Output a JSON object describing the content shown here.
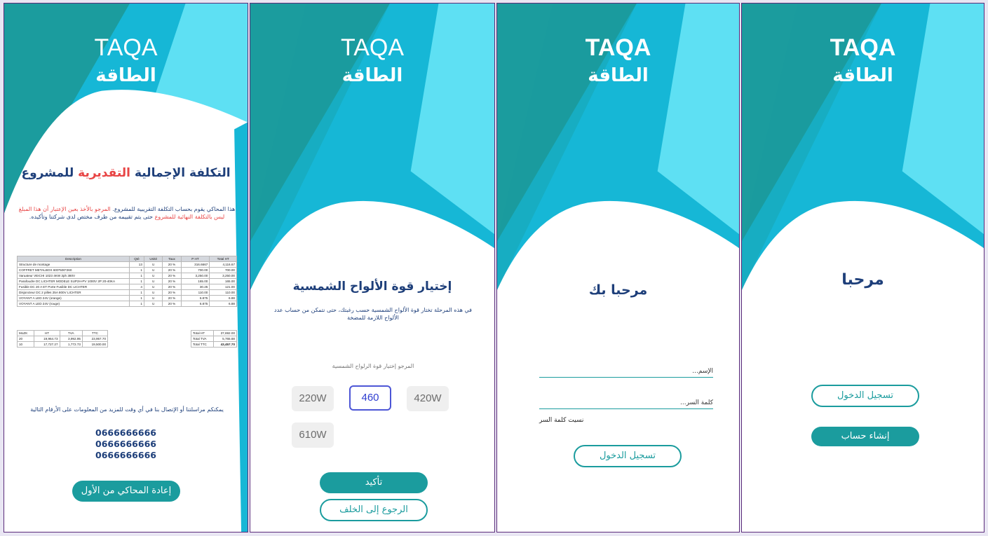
{
  "brand": {
    "name_en": "TAQA",
    "name_ar": "الطاقة"
  },
  "colors": {
    "teal": "#1b9c9e",
    "cyan": "#16b7d6",
    "light_cyan": "#5ee0f3",
    "navy": "#1e3f7a",
    "red": "#e84545",
    "accent_blue": "#2f3ed0"
  },
  "screen1": {
    "title_part1": "التكلفة الإجمالية",
    "title_part2": "التقديرية",
    "title_part3": "للمشروع",
    "desc_part1": "هذا المحاكي يقوم بحساب التكلفة التقريبية للمشروع.",
    "desc_part2": "المرجو بالأخذ بعين الإعتبار أن هذا المبلغ ليس بالتكلفة النهائية للمشروع",
    "desc_part3": "حتى يتم تقييمه من طرف مختص لدى شركتنا وتأكيده.",
    "table": {
      "headers": [
        "Description",
        "Qté",
        "Unité",
        "Taux",
        "P HT",
        "Total HT"
      ],
      "rows": [
        [
          "Structure de montage",
          "13",
          "U",
          "20 %",
          "316.6667",
          "4,116.67"
        ],
        [
          "COFFRET METALBOX 600*500*260",
          "1",
          "U",
          "20 %",
          "700.00",
          "700.00"
        ],
        [
          "Varuateur VEICHI 1023 4KW 3ph 380V",
          "1",
          "U",
          "20 %",
          "3,250.00",
          "3,250.00"
        ],
        [
          "Parafoudre DC LICHTER MODELE SUP2H-PV 1000V 2P 20-40KA",
          "1",
          "U",
          "20 %",
          "165.00",
          "165.00"
        ],
        [
          "Fusible DC 20 A ET Porte Fusible DC LICHTER",
          "4",
          "U",
          "20 %",
          "30.25",
          "121.00"
        ],
        [
          "Disjoncteur DC 2 pilles 25A 800V LICHTER",
          "1",
          "U",
          "20 %",
          "110.00",
          "110.00"
        ],
        [
          "VOYANT A LED 24V (orange)",
          "1",
          "U",
          "20 %",
          "6.875",
          "6.88"
        ],
        [
          "VOYANT A LED 24V (rouge)",
          "1",
          "U",
          "20 %",
          "6.875",
          "6.88"
        ]
      ],
      "tax_headers": [
        "MoZK",
        "HT",
        "TVA",
        "TTC"
      ],
      "tax_rows": [
        [
          "20",
          "19,964.73",
          "3,992.95",
          "23,957.70"
        ],
        [
          "10",
          "17,727.27",
          "1,772.73",
          "19,500.00"
        ]
      ],
      "totals": [
        [
          "Total HT",
          "37,692.00"
        ],
        [
          "Total TVA",
          "5,765.68"
        ],
        [
          "Total TTC",
          "43,457.70"
        ]
      ]
    },
    "contact_text": "يمكنكم مراسلتنا أو الإتصال بنا في أي وقت للمزيد من المعلومات على الأرقام التالية",
    "phones": [
      "0666666666",
      "0666666666",
      "0666666666"
    ],
    "restart_button": "إعادة المحاكي من الأول"
  },
  "screen2": {
    "title": "إختيار قوة الألواح الشمسية",
    "desc": "في هذه المرحلة تختار قوة الألواح الشمسية حسب رغبتك، حتى نتمكن من حساب عدد الألواح اللازمة للمضخة",
    "prompt": "المرجو إختيار قوة الرلواح الشمسية",
    "options": [
      "220W",
      "460",
      "420W",
      "610W"
    ],
    "selected": "460",
    "confirm_button": "تأكيد",
    "back_button": "الرجوع إلى الخلف"
  },
  "screen3": {
    "title": "مرحبا بك",
    "name_placeholder": "الإسم...",
    "password_placeholder": "كلمة السر...",
    "forgot_password": "نسيت كلمة السر",
    "login_button": "تسجيل الدخول"
  },
  "screen4": {
    "title": "مرحبا",
    "login_button": "تسجيل الدخول",
    "signup_button": "إنشاء حساب"
  }
}
